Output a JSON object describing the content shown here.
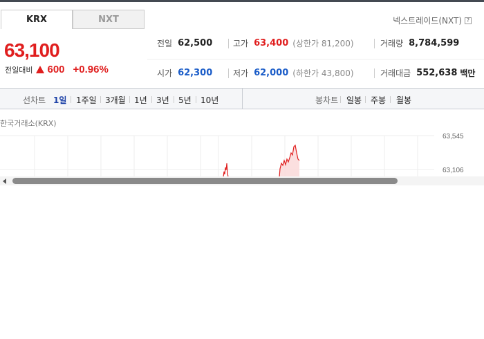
{
  "tabs": [
    {
      "label": "KRX",
      "active": true
    },
    {
      "label": "NXT",
      "active": false
    }
  ],
  "nxt_link": {
    "label": "넥스트레이드(NXT)",
    "icon": "help-icon"
  },
  "price": {
    "current": "63,100",
    "change_label": "전일대비",
    "change_icon": "up-triangle-icon",
    "change_value": "600",
    "change_pct": "+0.96%"
  },
  "stats": {
    "prev_close": {
      "label": "전일",
      "value": "62,500"
    },
    "high": {
      "label": "고가",
      "value": "63,400",
      "sub": "(상한가 81,200)"
    },
    "volume": {
      "label": "거래량",
      "value": "8,784,599"
    },
    "open": {
      "label": "시가",
      "value": "62,300"
    },
    "low": {
      "label": "저가",
      "value": "62,000",
      "sub": "(하한가 43,800)"
    },
    "amount": {
      "label": "거래대금",
      "value": "552,638",
      "unit": "백만"
    }
  },
  "toolbar": {
    "line_label": "선차트",
    "line_periods": [
      "1일",
      "1주일",
      "3개월",
      "1년",
      "3년",
      "5년",
      "10년"
    ],
    "active_period": "1일",
    "candle_label": "봉차트",
    "candle_periods": [
      "일봉",
      "주봉",
      "월봉"
    ]
  },
  "chart": {
    "title": "한국거래소(KRX)",
    "y_labels": [
      "63,545",
      "63,106"
    ]
  },
  "colors": {
    "up": "#e01e1e",
    "down": "#1a5cc8",
    "active_period": "#1a3fa6"
  }
}
